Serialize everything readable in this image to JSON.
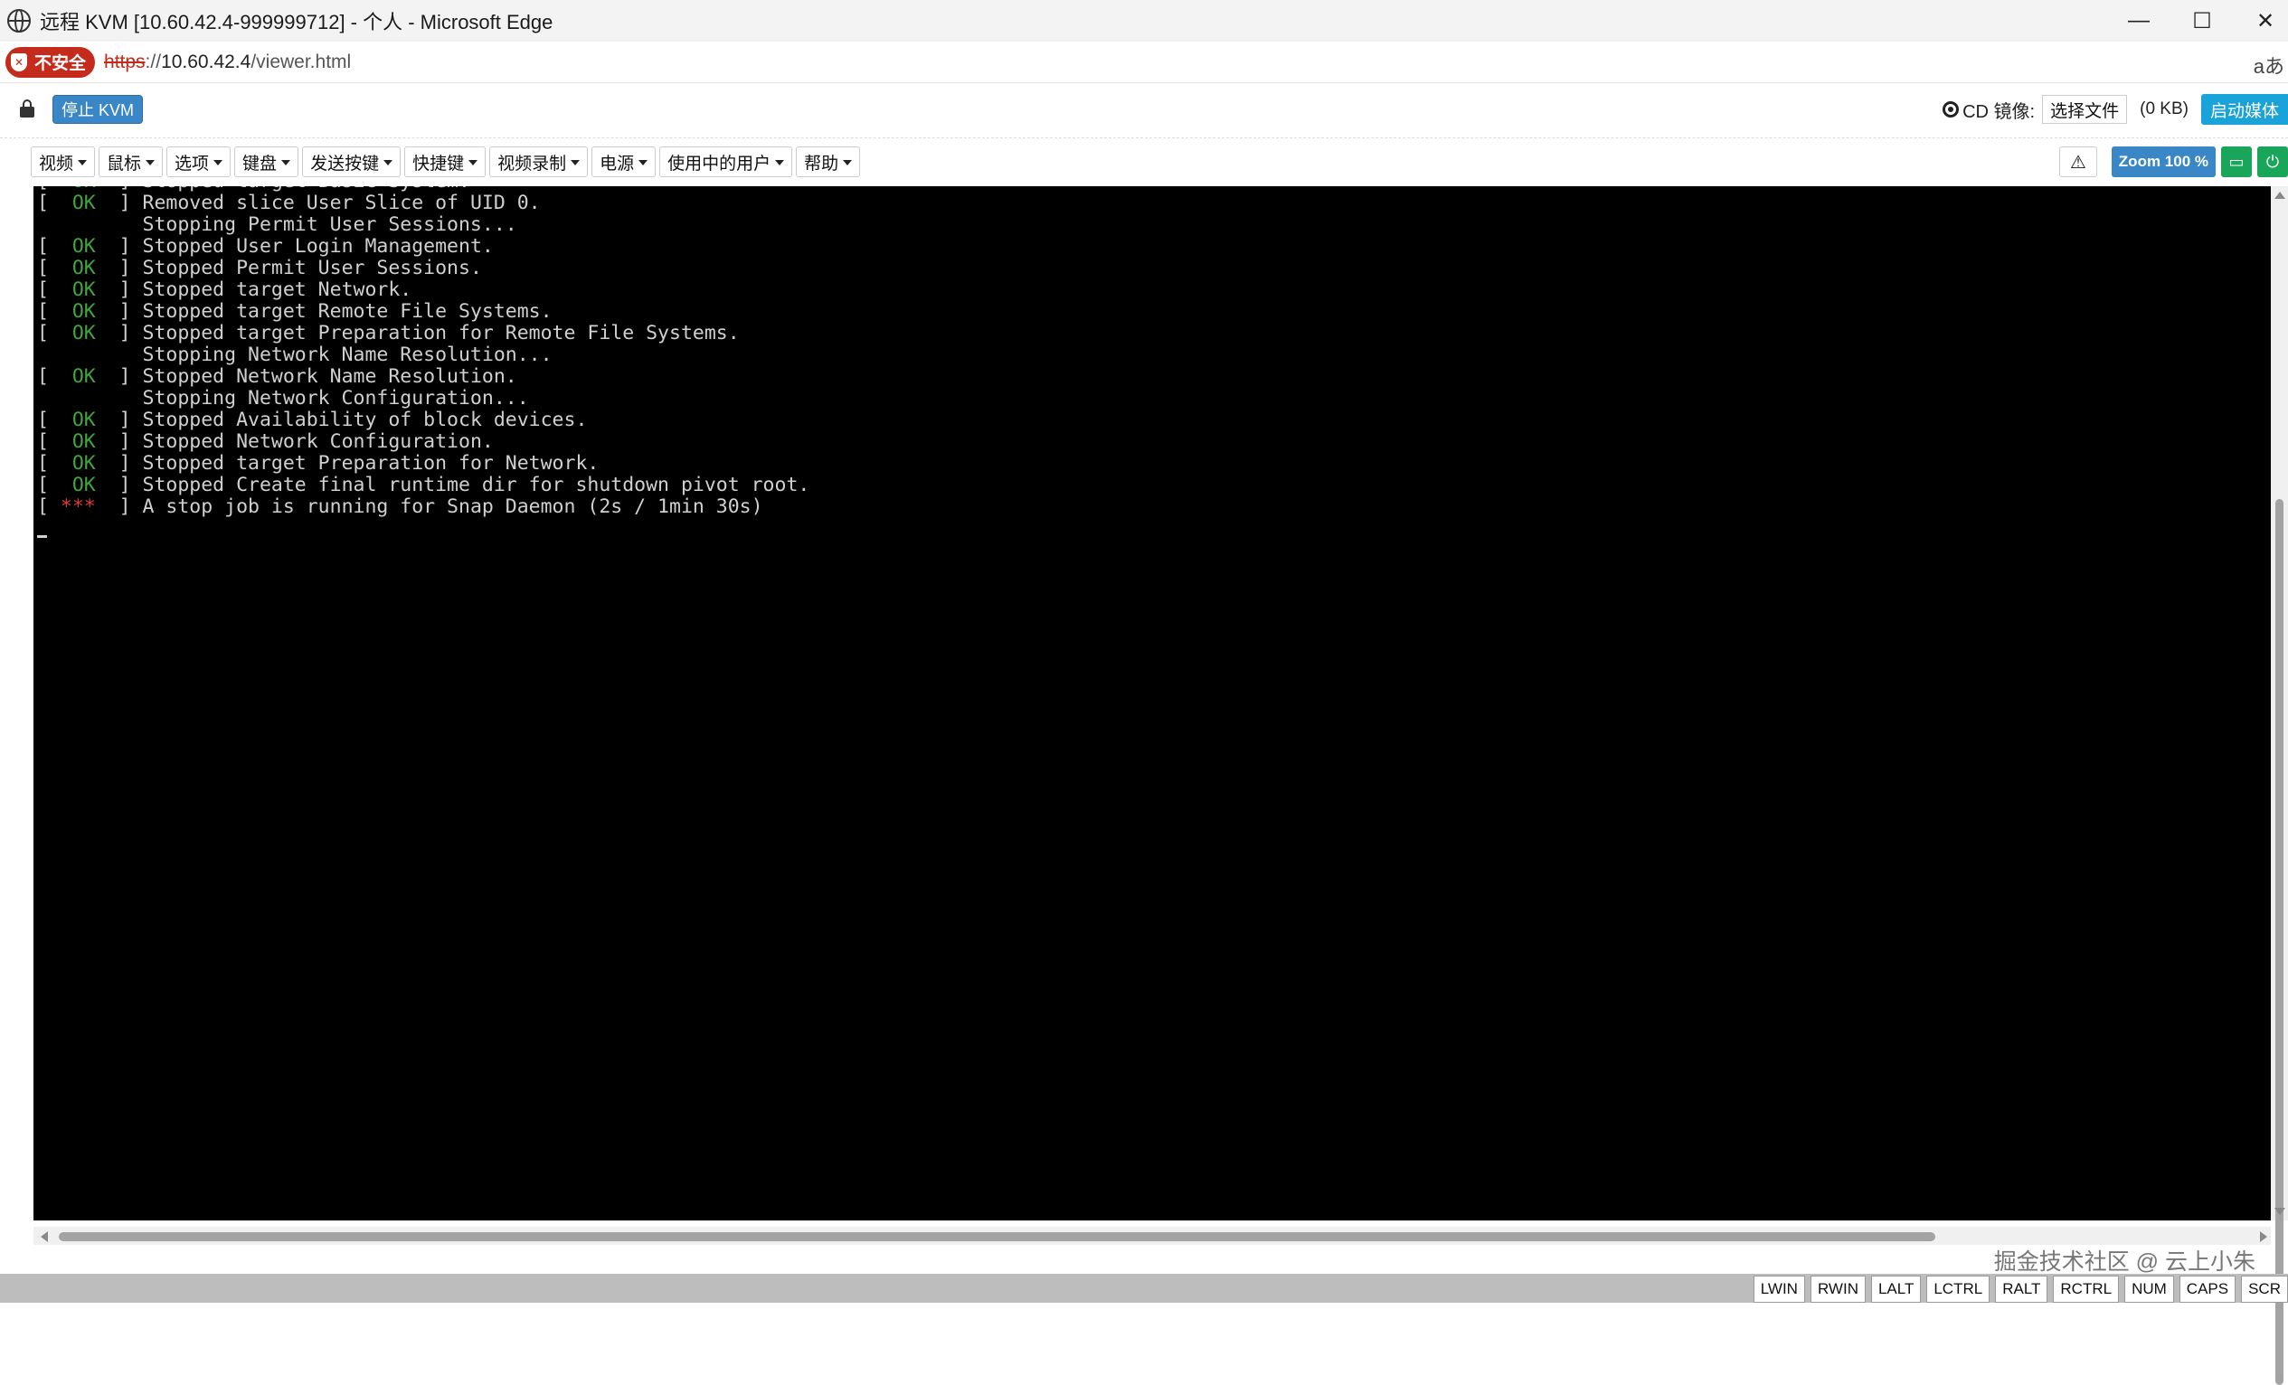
{
  "window": {
    "title": "远程 KVM [10.60.42.4-999999712] - 个人 - Microsoft Edge"
  },
  "address": {
    "security_label": "不安全",
    "protocol": "https",
    "separator": "://",
    "host": "10.60.42.4",
    "path": "/viewer.html",
    "read_aloud": "aあ"
  },
  "kvm": {
    "stop_label": "停止 KVM",
    "cd_label": "CD 镜像:",
    "choose_file_label": "选择文件",
    "file_size": "(0 KB)",
    "start_media_label": "启动媒体"
  },
  "menu": {
    "items": [
      "视频",
      "鼠标",
      "选项",
      "键盘",
      "发送按键",
      "快捷键",
      "视频录制",
      "电源",
      "使用中的用户",
      "帮助"
    ],
    "zoom_label": "Zoom 100 %",
    "warning_symbol": "⚠"
  },
  "console": {
    "lines": [
      {
        "status": "OK",
        "text": "Stopped target Basic System."
      },
      {
        "status": "OK",
        "text": "Removed slice User Slice of UID 0."
      },
      {
        "status": "",
        "text": "Stopping Permit User Sessions..."
      },
      {
        "status": "OK",
        "text": "Stopped User Login Management."
      },
      {
        "status": "OK",
        "text": "Stopped Permit User Sessions."
      },
      {
        "status": "OK",
        "text": "Stopped target Network."
      },
      {
        "status": "OK",
        "text": "Stopped target Remote File Systems."
      },
      {
        "status": "OK",
        "text": "Stopped target Preparation for Remote File Systems."
      },
      {
        "status": "",
        "text": "Stopping Network Name Resolution..."
      },
      {
        "status": "OK",
        "text": "Stopped Network Name Resolution."
      },
      {
        "status": "",
        "text": "Stopping Network Configuration..."
      },
      {
        "status": "OK",
        "text": "Stopped Availability of block devices."
      },
      {
        "status": "OK",
        "text": "Stopped Network Configuration."
      },
      {
        "status": "OK",
        "text": "Stopped target Preparation for Network."
      },
      {
        "status": "OK",
        "text": "Stopped Create final runtime dir for shutdown pivot root."
      },
      {
        "status": "***",
        "text": "A stop job is running for Snap Daemon (2s / 1min 30s)"
      }
    ]
  },
  "watermark": "掘金技术社区 @ 云上小朱",
  "status_keys": [
    "LWIN",
    "RWIN",
    "LALT",
    "LCTRL",
    "RALT",
    "RCTRL",
    "NUM",
    "CAPS",
    "SCR"
  ]
}
